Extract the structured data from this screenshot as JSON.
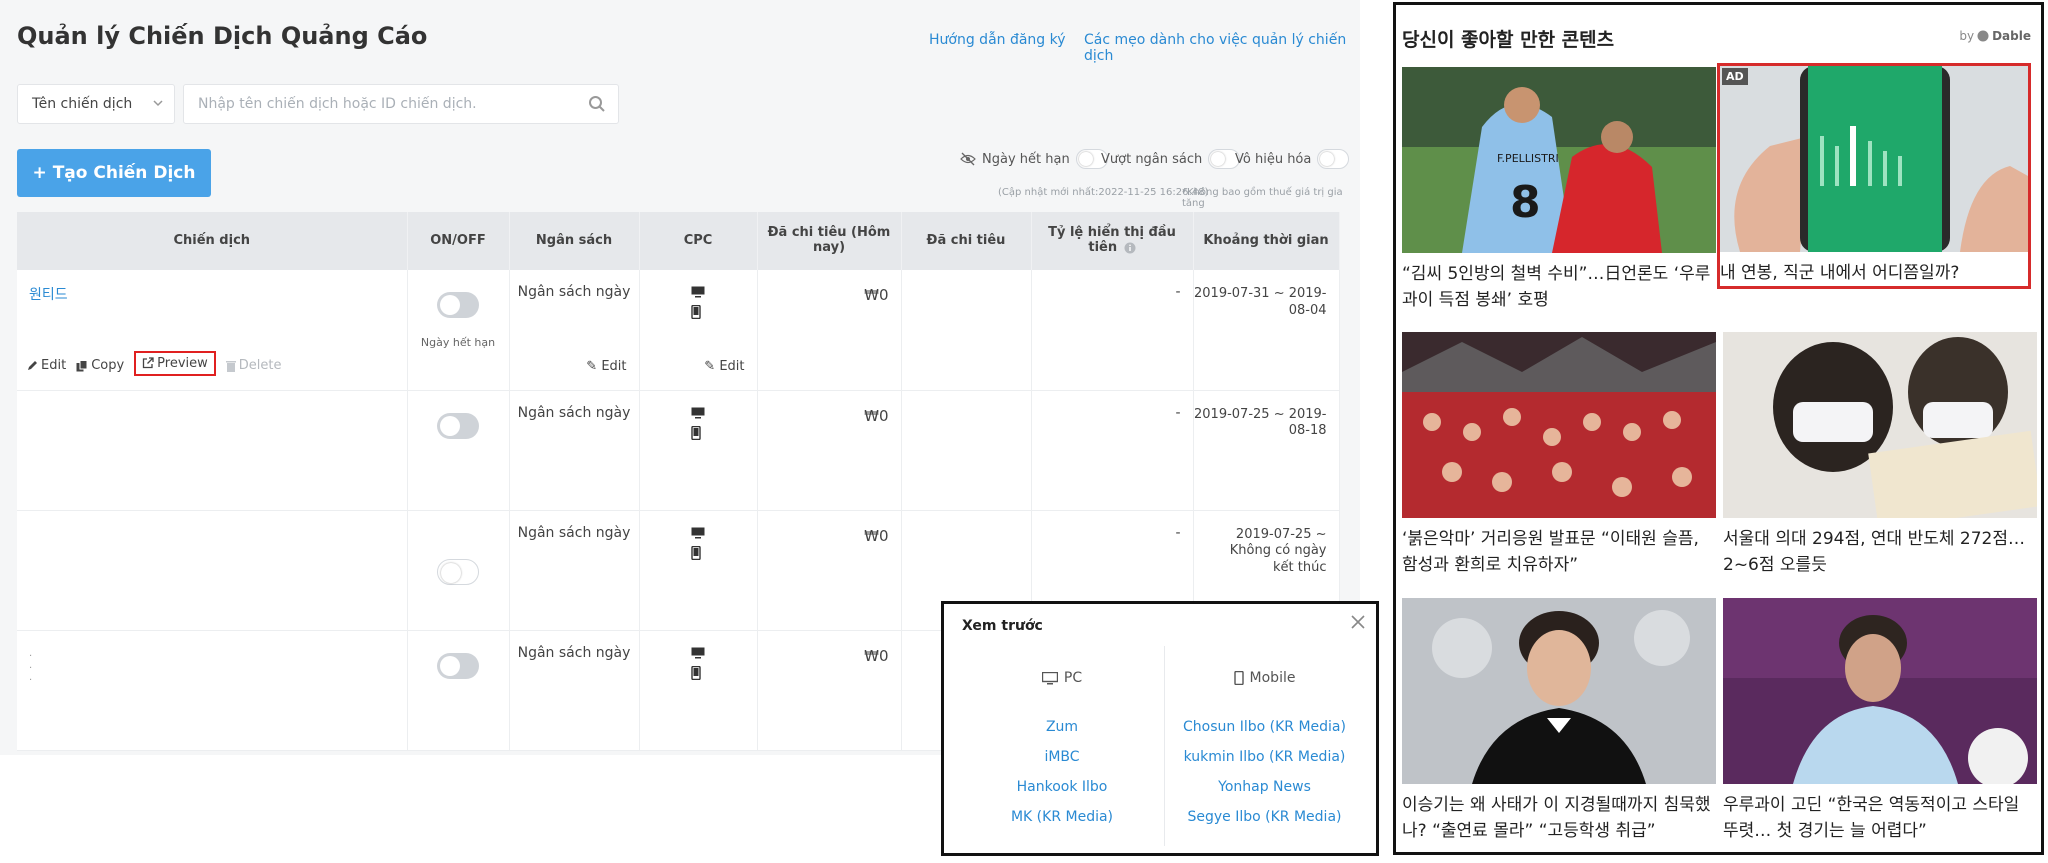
{
  "header": {
    "title": "Quản lý Chiến Dịch Quảng Cáo",
    "link_guide": "Hướng dẫn đăng ký",
    "link_tips": "Các mẹo dành cho việc quản lý chiến dịch"
  },
  "filter": {
    "select_value": "Tên chiến dịch",
    "search_placeholder": "Nhập tên chiến dịch hoặc ID chiến dịch."
  },
  "create_button": "+ Tạo Chiến Dịch",
  "toggles": {
    "expired": "Ngày hết hạn",
    "over_budget": "Vượt ngân sách",
    "disabled": "Vô hiệu hóa"
  },
  "notes": {
    "updated": "(Cập nhật mới nhất:2022-11-25 16:26:48)",
    "vat": "*Không bao gồm thuế giá trị gia tăng"
  },
  "table": {
    "headers": [
      "Chiến dịch",
      "ON/OFF",
      "Ngân sách",
      "CPC",
      "Đã chi tiêu (Hôm nay)",
      "Đã chi tiêu",
      "Tỷ lệ hiển thị đầu tiên",
      "Khoảng thời gian"
    ],
    "rows": [
      {
        "name": "원티드",
        "status_label": "Ngày hết hạn",
        "budget": "Ngân sách ngày",
        "spent_today": "₩0",
        "first_rate": "-",
        "period": "2019-07-31 ~ 2019-08-04"
      },
      {
        "name": "",
        "status_label": "",
        "budget": "Ngân sách ngày",
        "spent_today": "₩0",
        "first_rate": "-",
        "period": "2019-07-25 ~ 2019-08-18"
      },
      {
        "name": "",
        "status_label": "",
        "budget": "Ngân sách ngày",
        "spent_today": "₩0",
        "first_rate": "-",
        "period": "2019-07-25 ~ Không có ngày kết thúc"
      },
      {
        "name": "",
        "status_label": "",
        "budget": "Ngân sách ngày",
        "spent_today": "₩0",
        "first_rate": "",
        "period": ""
      }
    ],
    "actions": {
      "edit": "Edit",
      "copy": "Copy",
      "preview": "Preview",
      "delete": "Delete"
    },
    "edit_label": "Edit"
  },
  "preview_popup": {
    "title": "Xem trước",
    "pc_label": "PC",
    "mobile_label": "Mobile",
    "pc_media": [
      "Zum",
      "iMBC",
      "Hankook Ilbo",
      "MK (KR Media)"
    ],
    "mobile_media": [
      "Chosun Ilbo (KR Media)",
      "kukmin Ilbo (KR Media)",
      "Yonhap News",
      "Segye Ilbo (KR Media)"
    ]
  },
  "recommend": {
    "title": "당신이 좋아할 만한 콘텐츠",
    "by": "by",
    "brand": "Dable",
    "ad_badge": "AD",
    "cards": [
      {
        "caption": "“김씨 5인방의 철벽 수비”…日언론도 ‘우루과이 득점 봉쇄’ 호평",
        "jersey": "F.PELLISTRI"
      },
      {
        "caption": "내 연봉, 직군 내에서 어디쯤일까?"
      },
      {
        "caption": "‘붉은악마’ 거리응원 발표문 “이태원 슬픔, 함성과 환희로 치유하자”"
      },
      {
        "caption": "서울대 의대 294점, 연대 반도체 272점… 2~6점 오를듯"
      },
      {
        "caption": "이승기는 왜 사태가 이 지경될때까지 침묵했나? “출연료 몰라” “고등학생 취급”"
      },
      {
        "caption": "우루과이 고딘 “한국은 역동적이고 스타일 뚜렷… 첫 경기는 늘 어렵다”"
      }
    ]
  },
  "colors": {
    "accent": "#4aa3e8",
    "link": "#2a8ad3",
    "highlight": "#d62b2b"
  }
}
